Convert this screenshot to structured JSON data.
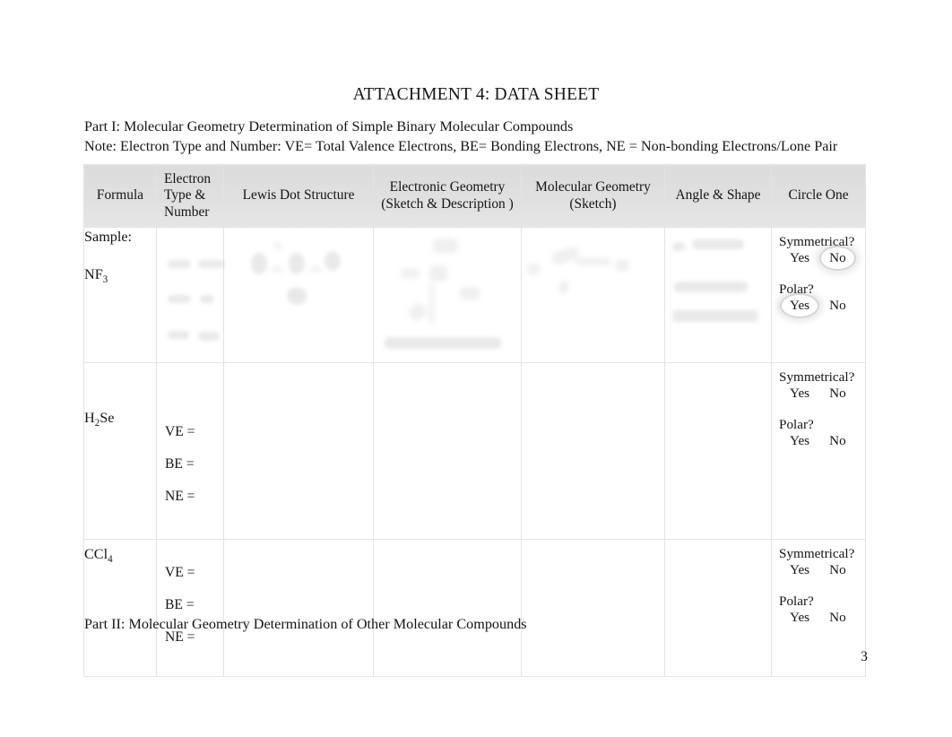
{
  "document": {
    "title": "ATTACHMENT 4: DATA SHEET",
    "part_i_heading": "Part I: Molecular Geometry Determination of Simple Binary Molecular Compounds",
    "note_line": "Note:  Electron Type and Number: VE= Total Valence Electrons, BE= Bonding Electrons, NE = Non-bonding Electrons/Lone Pair",
    "part_ii_heading": "Part II: Molecular Geometry Determination of Other Molecular Compounds",
    "page_number": "3"
  },
  "table": {
    "headers": {
      "formula": "Formula",
      "electron_line1": "Electron",
      "electron_line2": "Type &",
      "electron_line3": "Number",
      "lewis": "Lewis Dot Structure",
      "electronic_geometry_line1": "Electronic Geometry",
      "electronic_geometry_line2": "(Sketch & Description )",
      "molecular_geometry_line1": "Molecular Geometry",
      "molecular_geometry_line2": "(Sketch)",
      "angle_shape": "Angle & Shape",
      "circle_one": "Circle One"
    },
    "labels": {
      "ve": "VE =",
      "be": "BE =",
      "ne": "NE =",
      "symmetrical_question": "Symmetrical?",
      "polar_question": "Polar?",
      "yes": "Yes",
      "no": "No"
    },
    "rows": [
      {
        "sample_label": "Sample:",
        "formula_text": "NF",
        "formula_subscript": "3",
        "circle_one": {
          "symmetrical_answer": "No",
          "polar_answer": "Yes"
        }
      },
      {
        "formula_text": "H",
        "formula_subscript": "2",
        "formula_tail": "Se",
        "circle_one": {
          "symmetrical_answer": "",
          "polar_answer": ""
        }
      },
      {
        "formula_text": "CCl",
        "formula_subscript": "4",
        "circle_one": {
          "symmetrical_answer": "",
          "polar_answer": ""
        }
      }
    ]
  },
  "colors": {
    "header_background": "#dedede",
    "border": "#e3e3e3",
    "text": "#141414",
    "ink_ghost": "#b9b9b9"
  }
}
